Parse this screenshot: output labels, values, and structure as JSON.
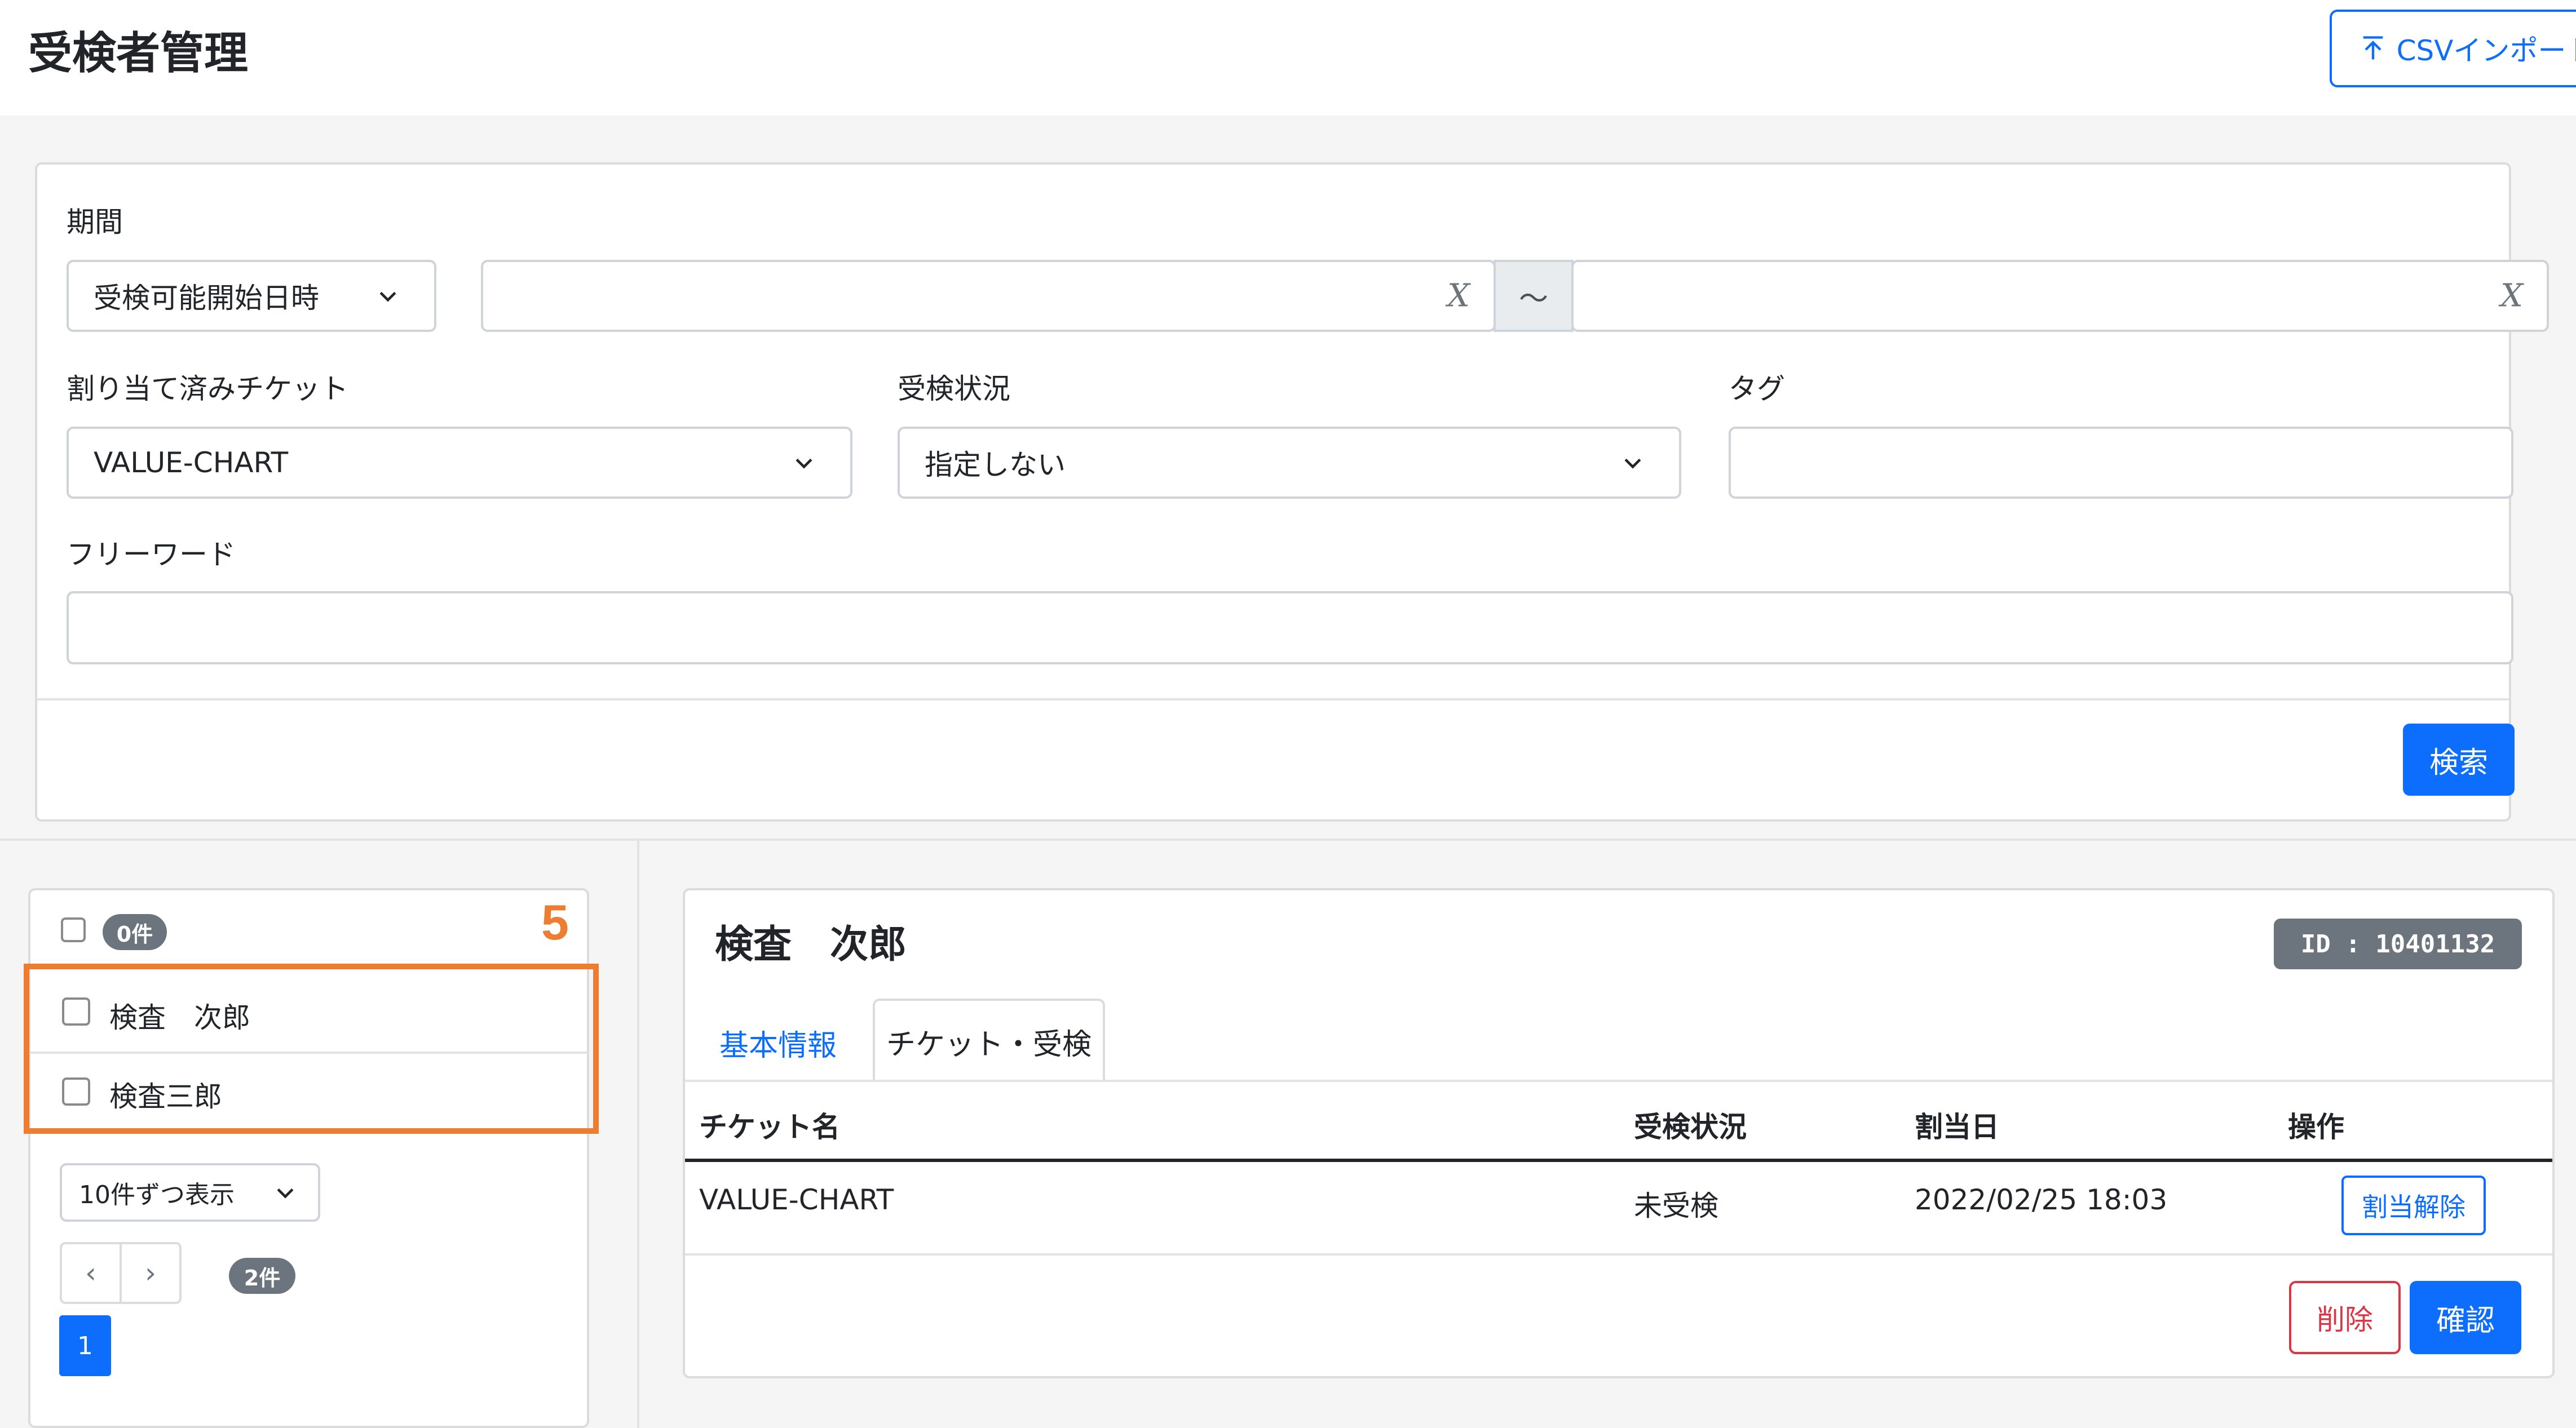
{
  "header": {
    "title": "受検者管理",
    "csv_import_label": "CSVインポート",
    "csv_import_icon": "upload-icon"
  },
  "filters": {
    "period_label": "期間",
    "period_type_value": "受検可能開始日時",
    "date_from_value": "",
    "date_clear_symbol": "X",
    "range_separator": "～",
    "date_to_value": "",
    "ticket_label": "割り当て済みチケット",
    "ticket_value": "VALUE-CHART",
    "status_label": "受検状況",
    "status_value": "指定しない",
    "tag_label": "タグ",
    "tag_value": "",
    "freeword_label": "フリーワード",
    "freeword_value": "",
    "search_button": "検索"
  },
  "list": {
    "selected_count": "0件",
    "step_number": "5",
    "items": [
      {
        "name": "検査　次郎"
      },
      {
        "name": "検査三郎"
      }
    ],
    "page_size_value": "10件ずつ表示",
    "prev": "‹",
    "next": "›",
    "total_count": "2件",
    "current_page": "1"
  },
  "detail": {
    "name": "検査　次郎",
    "id_badge": "ID : 10401132",
    "tabs": [
      {
        "label": "基本情報",
        "active": false
      },
      {
        "label": "チケット・受検",
        "active": true
      }
    ],
    "table": {
      "headers": [
        "チケット名",
        "受検状況",
        "割当日",
        "操作"
      ],
      "rows": [
        {
          "ticket": "VALUE-CHART",
          "status": "未受検",
          "assigned_date": "2022/02/25 18:03",
          "action": "割当解除"
        }
      ]
    },
    "delete_button": "削除",
    "confirm_button": "確認"
  },
  "colors": {
    "primary": "#0d6efd",
    "danger": "#dc3545",
    "secondary_badge": "#6c757d",
    "annotation_orange": "#ed7d31"
  }
}
